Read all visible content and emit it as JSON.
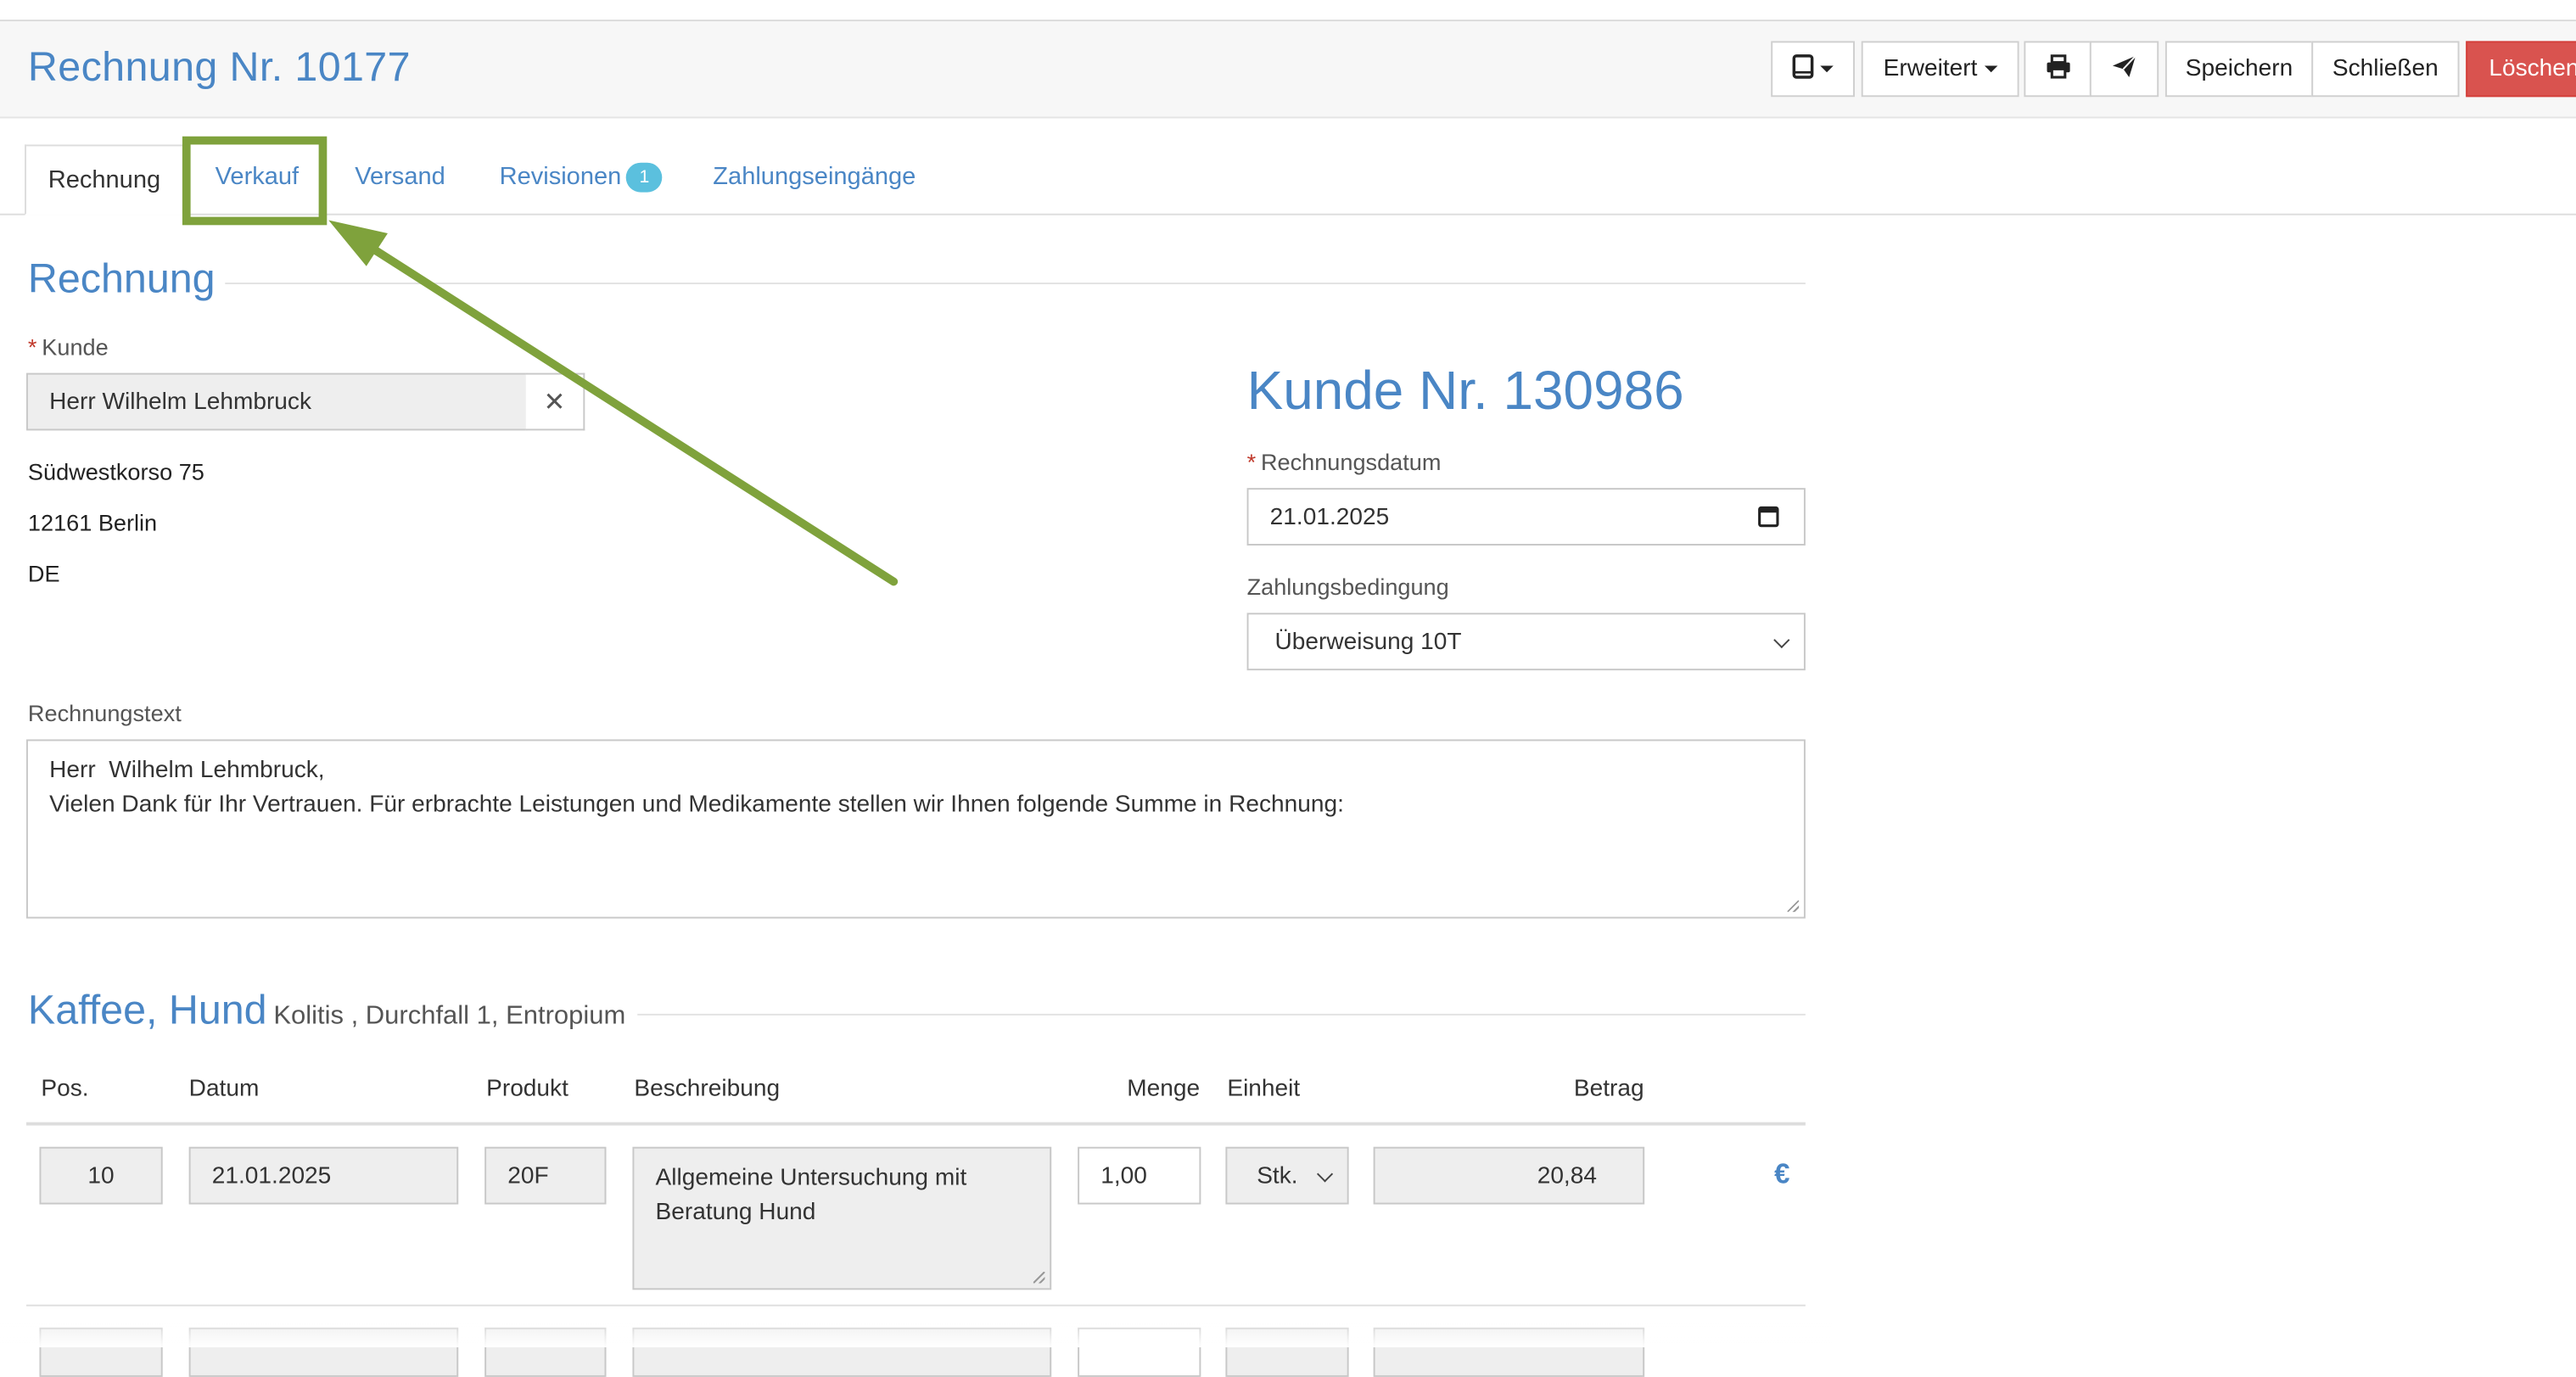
{
  "header": {
    "title": "Rechnung Nr. 10177",
    "buttons": {
      "erweitert": "Erweitert",
      "speichern": "Speichern",
      "schliessen": "Schließen",
      "loeschen": "Löschen"
    },
    "icons": [
      "tablet-icon",
      "print-icon",
      "send-icon"
    ]
  },
  "tabs": [
    {
      "label": "Rechnung",
      "active": true
    },
    {
      "label": "Verkauf",
      "highlighted": true
    },
    {
      "label": "Versand"
    },
    {
      "label": "Revisionen",
      "badge": "1"
    },
    {
      "label": "Zahlungseingänge"
    }
  ],
  "rechnung": {
    "section_title": "Rechnung",
    "kunde_label": "Kunde",
    "kunde_value": "Herr Wilhelm Lehmbruck",
    "address": [
      "Südwestkorso 75",
      "12161 Berlin",
      "DE"
    ],
    "kunde_nr": "Kunde Nr. 130986",
    "rechnungsdatum_label": "Rechnungsdatum",
    "rechnungsdatum_value": "21.01.2025",
    "zahlungsbedingung_label": "Zahlungsbedingung",
    "zahlungsbedingung_value": "Überweisung 10T",
    "rechnungstext_label": "Rechnungstext",
    "rechnungstext_lines": [
      "Herr  Wilhelm Lehmbruck,",
      "",
      "Vielen Dank für Ihr Vertrauen. Für erbrachte Leistungen und Medikamente stellen wir Ihnen folgende Summe in Rechnung:"
    ]
  },
  "patient": {
    "name": "Kaffee, Hund",
    "details": "Kolitis , Durchfall 1, Entropium"
  },
  "table": {
    "headers": {
      "pos": "Pos.",
      "datum": "Datum",
      "produkt": "Produkt",
      "beschreibung": "Beschreibung",
      "menge": "Menge",
      "einheit": "Einheit",
      "betrag": "Betrag"
    },
    "rows": [
      {
        "pos": "10",
        "datum": "21.01.2025",
        "produkt": "20F",
        "beschreibung": "Allgemeine Untersuchung mit Beratung Hund",
        "menge": "1,00",
        "einheit": "Stk.",
        "betrag": "20,84",
        "currency": "€"
      }
    ]
  },
  "colors": {
    "accent": "#4a86c5",
    "danger": "#d9534f",
    "highlight": "#7fa23c",
    "badge": "#5bc0de"
  }
}
